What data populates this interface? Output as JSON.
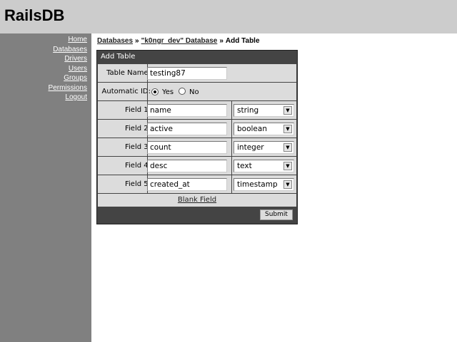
{
  "app": {
    "title": "RailsDB"
  },
  "sidebar": {
    "items": [
      {
        "label": "Home"
      },
      {
        "label": "Databases"
      },
      {
        "label": "Drivers"
      },
      {
        "label": "Users"
      },
      {
        "label": "Groups"
      },
      {
        "label": "Permissions"
      },
      {
        "label": "Logout"
      }
    ]
  },
  "breadcrumb": {
    "items": [
      {
        "label": "Databases"
      },
      {
        "label": "\"k0ngr_dev\" Database"
      },
      {
        "label": "Add Table"
      }
    ],
    "separator": "»"
  },
  "form": {
    "title": "Add Table",
    "table_name_label": "Table Name:",
    "table_name_value": "testing87",
    "auto_id_label": "Automatic ID:",
    "auto_id_options": [
      {
        "label": "Yes",
        "selected": true
      },
      {
        "label": "No",
        "selected": false
      }
    ],
    "fields": [
      {
        "label": "Field 1:",
        "name": "name",
        "type": "string"
      },
      {
        "label": "Field 2:",
        "name": "active",
        "type": "boolean"
      },
      {
        "label": "Field 3:",
        "name": "count",
        "type": "integer"
      },
      {
        "label": "Field 4:",
        "name": "desc",
        "type": "text"
      },
      {
        "label": "Field 5:",
        "name": "created_at",
        "type": "timestamp"
      }
    ],
    "blank_field_label": "Blank Field",
    "submit_label": "Submit"
  }
}
